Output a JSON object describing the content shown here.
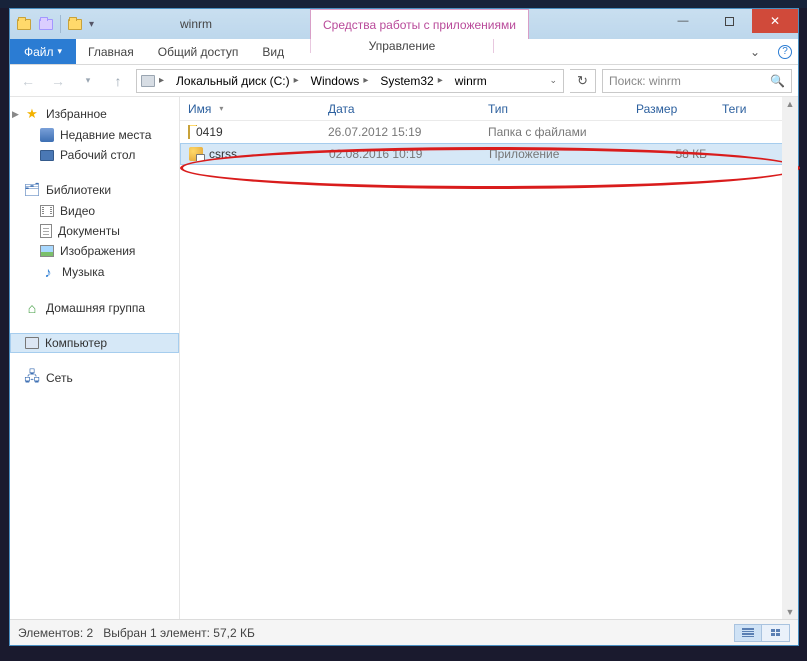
{
  "titlebar": {
    "title": "winrm"
  },
  "contextual_tab": {
    "label": "Средства работы с приложениями"
  },
  "window_controls": {
    "min": "—",
    "max": "□",
    "close": "✕"
  },
  "ribbon": {
    "file": "Файл",
    "tabs": [
      "Главная",
      "Общий доступ",
      "Вид"
    ],
    "context_tab": "Управление"
  },
  "address": {
    "segments": [
      "Локальный диск (C:)",
      "Windows",
      "System32",
      "winrm"
    ]
  },
  "search": {
    "placeholder": "Поиск: winrm"
  },
  "nav": {
    "favorites": {
      "label": "Избранное",
      "items": [
        {
          "label": "Недавние места",
          "icon": "recent"
        },
        {
          "label": "Рабочий стол",
          "icon": "desktop"
        }
      ]
    },
    "libraries": {
      "label": "Библиотеки",
      "items": [
        {
          "label": "Видео",
          "icon": "video"
        },
        {
          "label": "Документы",
          "icon": "doc"
        },
        {
          "label": "Изображения",
          "icon": "img"
        },
        {
          "label": "Музыка",
          "icon": "music"
        }
      ]
    },
    "homegroup": {
      "label": "Домашняя группа"
    },
    "computer": {
      "label": "Компьютер"
    },
    "network": {
      "label": "Сеть"
    }
  },
  "columns": {
    "name": "Имя",
    "date": "Дата",
    "type": "Тип",
    "size": "Размер",
    "tags": "Теги"
  },
  "rows": [
    {
      "name": "0419",
      "date": "26.07.2012 15:19",
      "type": "Папка с файлами",
      "size": "",
      "kind": "folder",
      "selected": false
    },
    {
      "name": "csrss",
      "date": "02.08.2016 10:19",
      "type": "Приложение",
      "size": "58 КБ",
      "kind": "app",
      "selected": true
    }
  ],
  "status": {
    "count_label": "Элементов:",
    "count_value": "2",
    "selection": "Выбран 1 элемент: 57,2 КБ"
  }
}
